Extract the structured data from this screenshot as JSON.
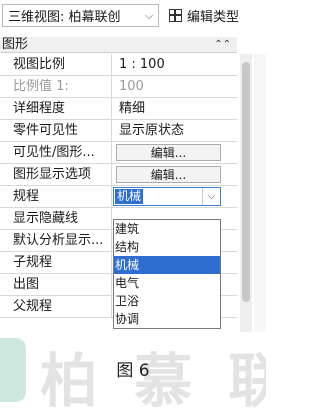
{
  "topbar": {
    "view_name": "三维视图: 柏幕联创",
    "edit_type_label": "编辑类型"
  },
  "section": {
    "title": "图形",
    "collapse_glyph": "⌃⌃"
  },
  "properties": [
    {
      "label": "视图比例",
      "value": "1 : 100"
    },
    {
      "label": "比例值 1:",
      "value": "100"
    },
    {
      "label": "详细程度",
      "value": "精细"
    },
    {
      "label": "零件可见性",
      "value": "显示原状态"
    },
    {
      "label": "可见性/图形...",
      "value": "编辑..."
    },
    {
      "label": "图形显示选项",
      "value": "编辑..."
    },
    {
      "label": "规程",
      "value": "机械"
    },
    {
      "label": "显示隐藏线",
      "value": ""
    },
    {
      "label": "默认分析显示...",
      "value": ""
    },
    {
      "label": "子规程",
      "value": ""
    },
    {
      "label": "出图",
      "value": ""
    },
    {
      "label": "父规程",
      "value": ""
    }
  ],
  "dropdown_options": [
    "建筑",
    "结构",
    "机械",
    "电气",
    "卫浴",
    "协调"
  ],
  "dropdown_selected": "机械",
  "watermark": "柏 慕 联",
  "caption": "图 6"
}
